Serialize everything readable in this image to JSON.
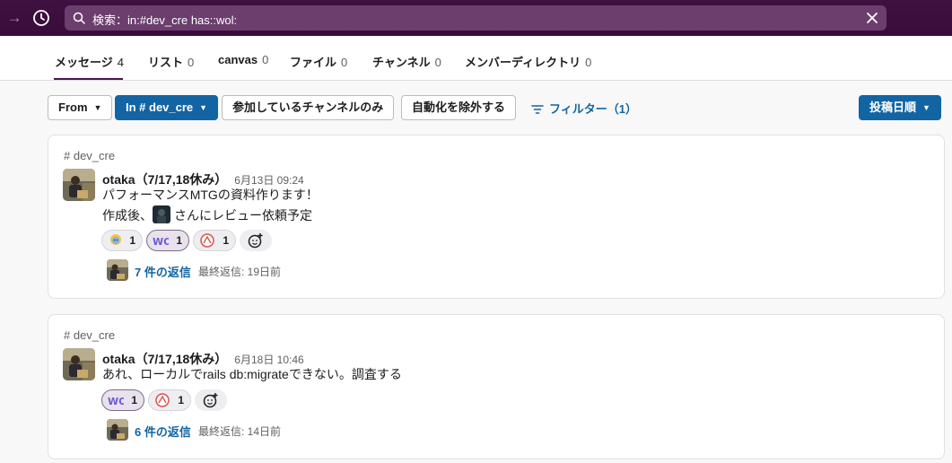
{
  "search": {
    "query": "検索：in:#dev_cre has::wol:"
  },
  "tabs": [
    {
      "label": "メッセージ",
      "count": "4"
    },
    {
      "label": "リスト",
      "count": "0"
    },
    {
      "label": "canvas",
      "count": "0"
    },
    {
      "label": "ファイル",
      "count": "0"
    },
    {
      "label": "チャンネル",
      "count": "0"
    },
    {
      "label": "メンバーディレクトリ",
      "count": "0"
    }
  ],
  "filters": {
    "from_label": "From",
    "in_label": "In # dev_cre",
    "joined_label": "参加しているチャンネルのみ",
    "exclude_auto_label": "自動化を除外する",
    "filter_label": "フィルター（1）",
    "sort_label": "投稿日順"
  },
  "results": [
    {
      "channel": "# dev_cre",
      "user": "otaka（7/17,18休み）",
      "timestamp": "6月13日 09:24",
      "line1": "パフォーマンスMTGの資料作ります！",
      "line2_before": "作成後、",
      "line2_after": "さんにレビュー依頼予定",
      "reactions": [
        {
          "emoji": "person-emoji",
          "count": "1"
        },
        {
          "emoji": "wol-emoji",
          "count": "1"
        },
        {
          "emoji": "badge-emoji",
          "count": "1"
        }
      ],
      "replies": "7 件の返信",
      "last_reply": "最終返信: 19日前"
    },
    {
      "channel": "# dev_cre",
      "user": "otaka（7/17,18休み）",
      "timestamp": "6月18日 10:46",
      "line1": "あれ、ローカルでrails db:migrateできない。調査する",
      "reactions": [
        {
          "emoji": "wol-emoji",
          "count": "1"
        },
        {
          "emoji": "badge-emoji",
          "count": "1"
        }
      ],
      "replies": "6 件の返信",
      "last_reply": "最終返信: 14日前"
    }
  ],
  "colors": {
    "topbar": "#3f0e40",
    "accent_blue": "#1264a3",
    "tab_underline": "#4a154b"
  }
}
